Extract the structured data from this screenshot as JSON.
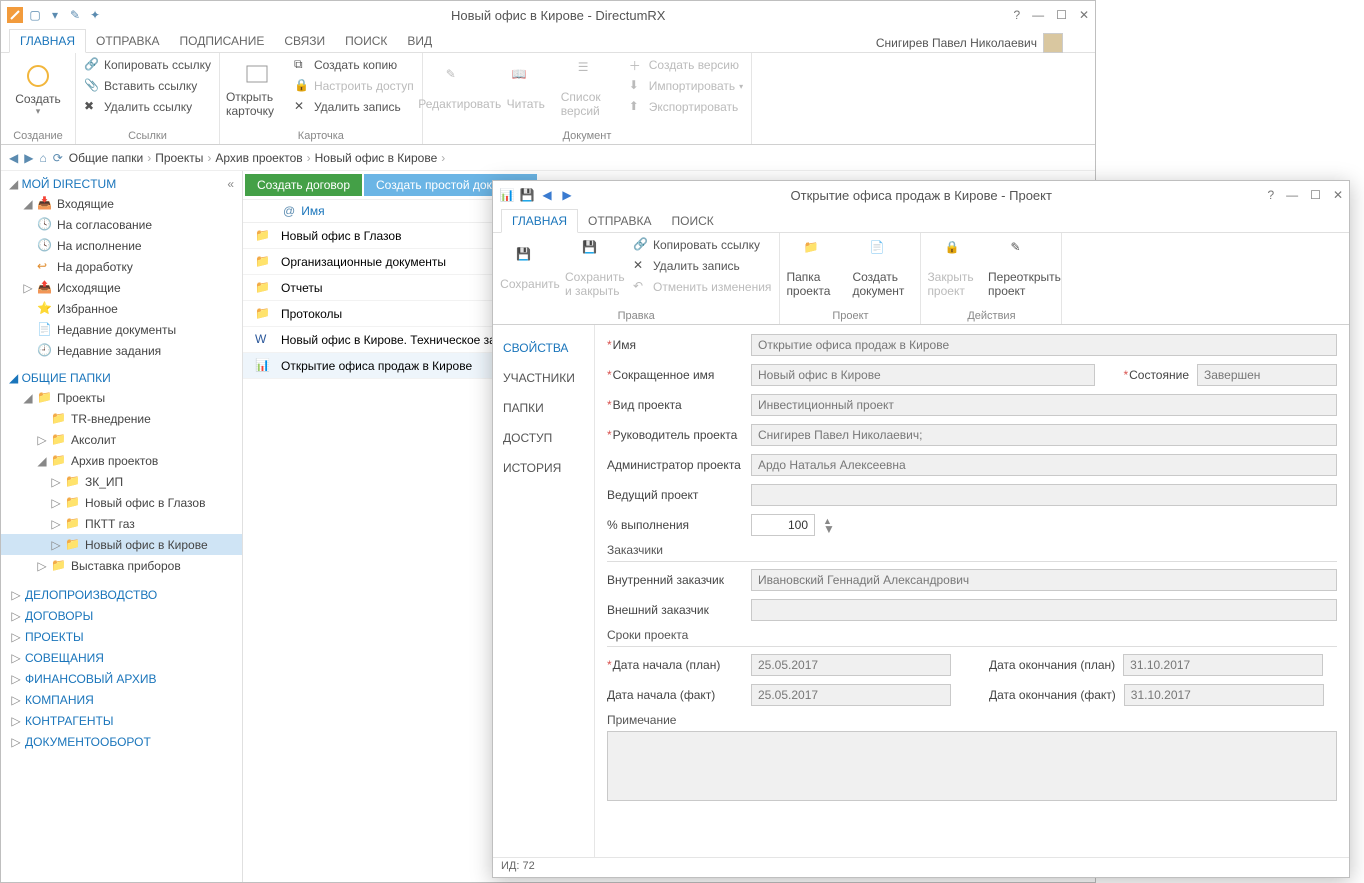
{
  "main": {
    "title": "Новый офис в Кирове - DirectumRX",
    "user": "Снигирев Павел Николаевич",
    "tabs": [
      "ГЛАВНАЯ",
      "ОТПРАВКА",
      "ПОДПИСАНИЕ",
      "СВЯЗИ",
      "ПОИСК",
      "ВИД"
    ],
    "ribbon": {
      "create": {
        "big": "Создать",
        "label": "Создание"
      },
      "links": {
        "copy": "Копировать ссылку",
        "paste": "Вставить ссылку",
        "delete": "Удалить ссылку",
        "label": "Ссылки"
      },
      "card": {
        "open": "Открыть карточку",
        "createcopy": "Создать копию",
        "access": "Настроить доступ",
        "delrec": "Удалить запись",
        "label": "Карточка"
      },
      "doc": {
        "edit": "Редактировать",
        "read": "Читать",
        "versions": "Список версий",
        "createver": "Создать версию",
        "import": "Импортировать",
        "export": "Экспортировать",
        "label": "Документ"
      }
    },
    "crumbs": [
      "Общие папки",
      "Проекты",
      "Архив проектов",
      "Новый офис в Кирове"
    ],
    "nav": {
      "mydirectum": "МОЙ DIRECTUM",
      "inbox": "Входящие",
      "approval": "На согласование",
      "execution": "На исполнение",
      "rework": "На доработку",
      "outbox": "Исходящие",
      "favorites": "Избранное",
      "recentdocs": "Недавние документы",
      "recenttasks": "Недавние задания",
      "shared": "ОБЩИЕ ПАПКИ",
      "projects": "Проекты",
      "tr": "TR-внедрение",
      "aksolit": "Аксолит",
      "archive": "Архив проектов",
      "zkip": "ЗК_ИП",
      "glazov": "Новый офис в Глазов",
      "pktt": "ПКТТ газ",
      "kirov": "Новый офис в Кирове",
      "exhibit": "Выставка приборов",
      "cats": [
        "ДЕЛОПРОИЗВОДСТВО",
        "ДОГОВОРЫ",
        "ПРОЕКТЫ",
        "СОВЕЩАНИЯ",
        "ФИНАНСОВЫЙ АРХИВ",
        "КОМПАНИЯ",
        "КОНТРАГЕНТЫ",
        "ДОКУМЕНТООБОРОТ"
      ]
    },
    "content": {
      "btn1": "Создать договор",
      "btn2": "Создать простой документ",
      "colname": "Имя",
      "rows": [
        "Новый офис в Глазов",
        "Организационные документы",
        "Отчеты",
        "Протоколы",
        "Новый офис в Кирове. Техническое задание",
        "Открытие офиса продаж в Кирове"
      ]
    }
  },
  "dlg": {
    "title": "Открытие офиса продаж в Кирове - Проект",
    "tabs": [
      "ГЛАВНАЯ",
      "ОТПРАВКА",
      "ПОИСК"
    ],
    "ribbon": {
      "save": "Сохранить",
      "saveclose": "Сохранить и закрыть",
      "copy": "Копировать ссылку",
      "del": "Удалить запись",
      "undo": "Отменить изменения",
      "editlabel": "Правка",
      "folder": "Папка проекта",
      "createdoc": "Создать документ",
      "projlabel": "Проект",
      "close": "Закрыть проект",
      "reopen": "Переоткрыть проект",
      "actlabel": "Действия"
    },
    "side": [
      "СВОЙСТВА",
      "УЧАСТНИКИ",
      "ПАПКИ",
      "ДОСТУП",
      "ИСТОРИЯ"
    ],
    "form": {
      "name_l": "Имя",
      "name_v": "Открытие офиса продаж в Кирове",
      "short_l": "Сокращенное имя",
      "short_v": "Новый офис в Кирове",
      "state_l": "Состояние",
      "state_v": "Завершен",
      "type_l": "Вид проекта",
      "type_v": "Инвестиционный проект",
      "mgr_l": "Руководитель проекта",
      "mgr_v": "Снигирев Павел Николаевич;",
      "admin_l": "Администратор проекта",
      "admin_v": "Ардо Наталья Алексеевна",
      "lead_l": "Ведущий проект",
      "lead_v": "",
      "pct_l": "% выполнения",
      "pct_v": "100",
      "cust": "Заказчики",
      "intcust_l": "Внутренний заказчик",
      "intcust_v": "Ивановский Геннадий Александрович",
      "extcust_l": "Внешний заказчик",
      "extcust_v": "",
      "dates": "Сроки проекта",
      "startplan_l": "Дата начала (план)",
      "startplan_v": "25.05.2017",
      "endplan_l": "Дата окончания (план)",
      "endplan_v": "31.10.2017",
      "startfact_l": "Дата начала (факт)",
      "startfact_v": "25.05.2017",
      "endfact_l": "Дата окончания (факт)",
      "endfact_v": "31.10.2017",
      "note_l": "Примечание"
    },
    "footer": "ИД: 72"
  }
}
